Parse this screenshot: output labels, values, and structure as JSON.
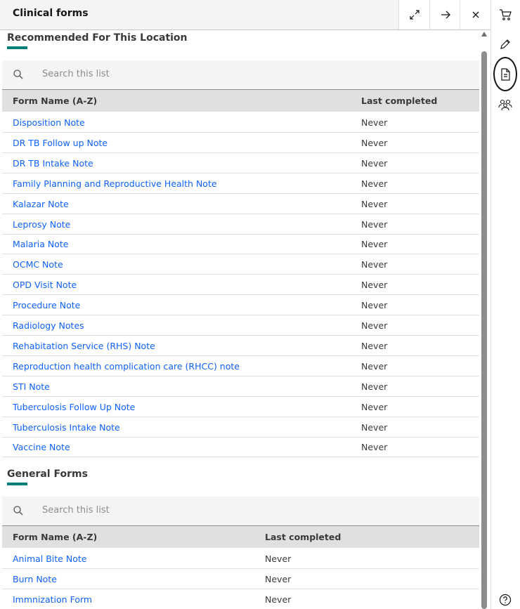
{
  "header": {
    "title": "Clinical forms",
    "maximize_icon": "maximize-icon",
    "arrow_icon": "arrow-right-icon",
    "close_icon": "close-icon"
  },
  "recommended": {
    "title": "Recommended For This Location",
    "search_placeholder": "Search this list",
    "columns": {
      "name": "Form Name (A-Z)",
      "last": "Last completed"
    },
    "rows": [
      {
        "name": "Disposition Note",
        "last": "Never"
      },
      {
        "name": "DR TB Follow up Note",
        "last": "Never"
      },
      {
        "name": "DR TB Intake Note",
        "last": "Never"
      },
      {
        "name": "Family Planning and Reproductive Health Note",
        "last": "Never"
      },
      {
        "name": "Kalazar Note",
        "last": "Never"
      },
      {
        "name": "Leprosy Note",
        "last": "Never"
      },
      {
        "name": "Malaria Note",
        "last": "Never"
      },
      {
        "name": "OCMC Note",
        "last": "Never"
      },
      {
        "name": "OPD Visit Note",
        "last": "Never"
      },
      {
        "name": "Procedure Note",
        "last": "Never"
      },
      {
        "name": "Radiology Notes",
        "last": "Never"
      },
      {
        "name": "Rehabitation Service (RHS) Note",
        "last": "Never"
      },
      {
        "name": "Reproduction health complication care (RHCC) note",
        "last": "Never"
      },
      {
        "name": "STI Note",
        "last": "Never"
      },
      {
        "name": "Tuberculosis Follow Up Note",
        "last": "Never"
      },
      {
        "name": "Tuberculosis Intake Note",
        "last": "Never"
      },
      {
        "name": "Vaccine Note",
        "last": "Never"
      }
    ]
  },
  "general": {
    "title": "General Forms",
    "search_placeholder": "Search this list",
    "columns": {
      "name": "Form Name (A-Z)",
      "last": "Last completed"
    },
    "rows": [
      {
        "name": "Animal Bite Note",
        "last": "Never"
      },
      {
        "name": "Burn Note",
        "last": "Never"
      },
      {
        "name": "Immnization Form",
        "last": "Never"
      }
    ]
  },
  "rail": {
    "icons": [
      "cart-icon",
      "pen-icon",
      "document-icon",
      "group-icon",
      "help-icon"
    ]
  },
  "colors": {
    "accent": "#007d79",
    "link": "#0f62fe",
    "header_bg": "#f4f4f4",
    "table_header_bg": "#e0e0e0"
  }
}
